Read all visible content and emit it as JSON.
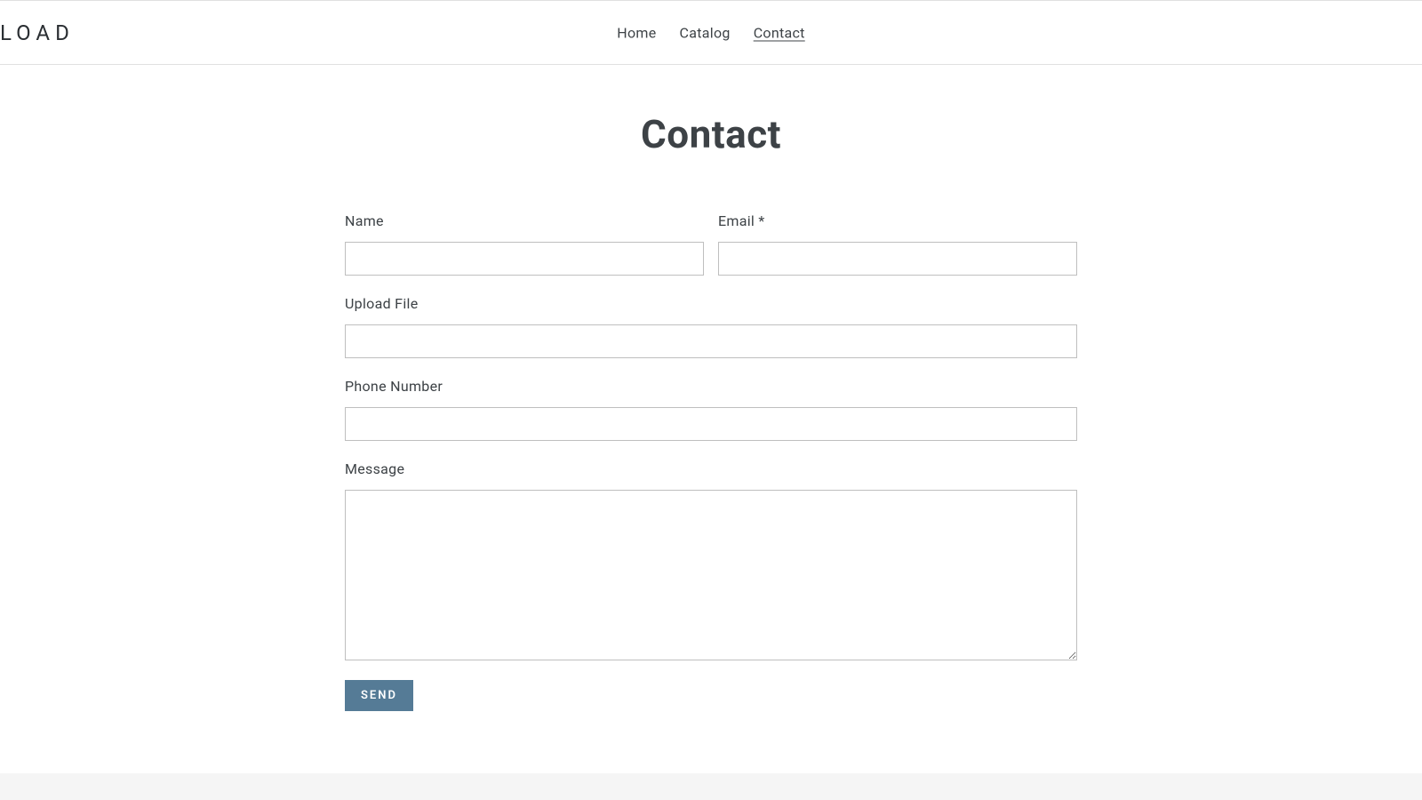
{
  "brand": "LOAD",
  "nav": {
    "home": "Home",
    "catalog": "Catalog",
    "contact": "Contact"
  },
  "page_title": "Contact",
  "form": {
    "name_label": "Name",
    "email_label": "Email *",
    "upload_label": "Upload File",
    "phone_label": "Phone Number",
    "message_label": "Message",
    "name_value": "",
    "email_value": "",
    "upload_value": "",
    "phone_value": "",
    "message_value": "",
    "send_button": "SEND"
  }
}
